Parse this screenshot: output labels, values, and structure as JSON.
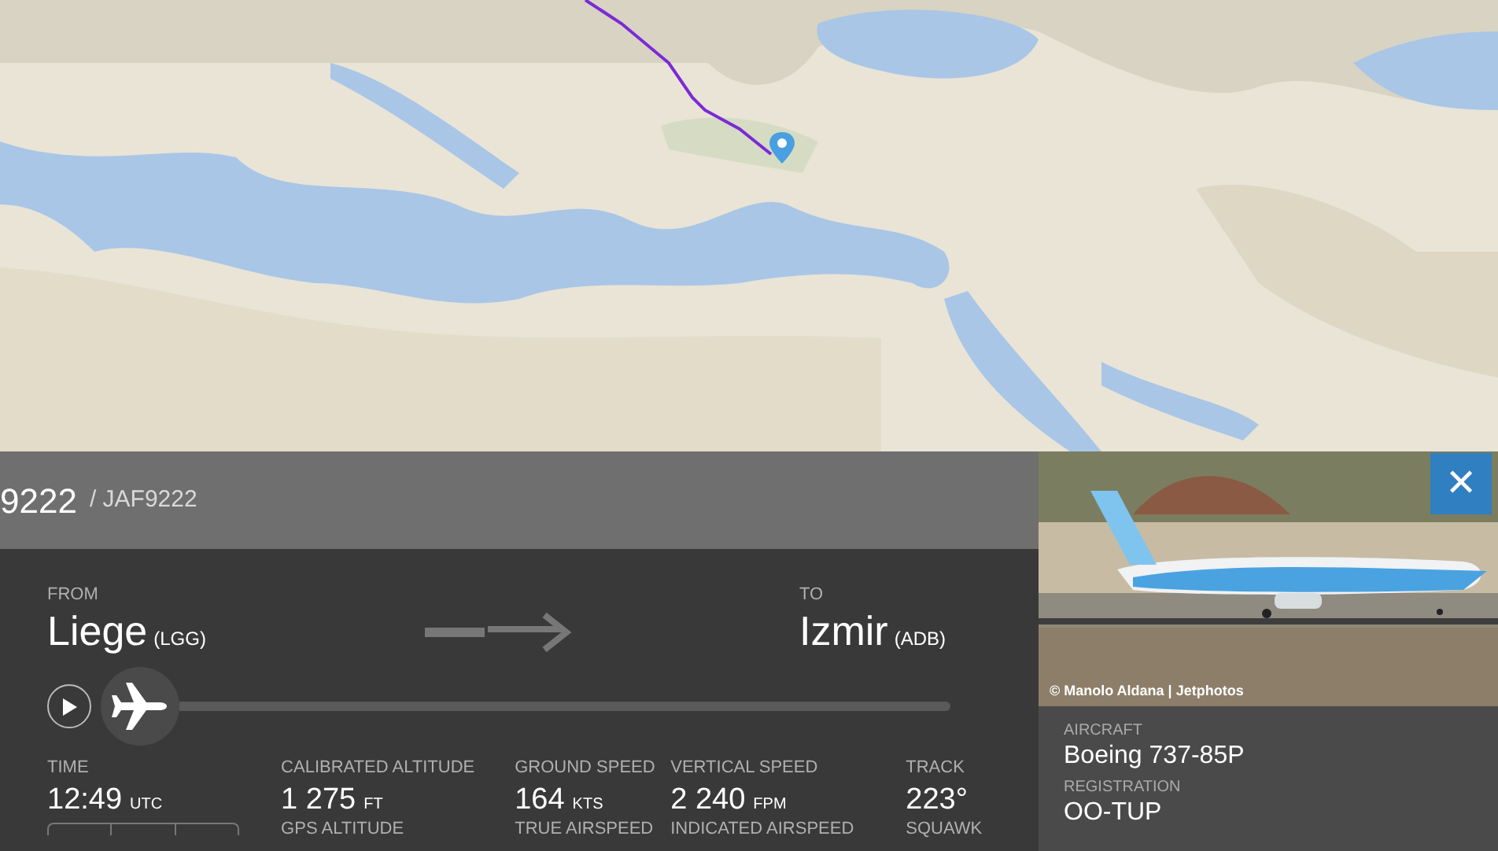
{
  "flight": {
    "number": "9222",
    "callsign": "/ JAF9222",
    "close": "✕"
  },
  "route": {
    "from_label": "FROM",
    "from_city": "Liege",
    "from_code": "(LGG)",
    "to_label": "TO",
    "to_city": "Izmir",
    "to_code": "(ADB)"
  },
  "progress": {
    "level": 0.0
  },
  "stats": [
    {
      "label": "TIME",
      "value": "12:49",
      "unit": "UTC"
    },
    {
      "label": "CALIBRATED ALTITUDE",
      "value": "1 275",
      "unit": "FT",
      "next_label": "GPS ALTITUDE"
    },
    {
      "label": "GROUND SPEED",
      "value": "164",
      "unit": "KTS",
      "next_label": "TRUE AIRSPEED"
    },
    {
      "label": "VERTICAL SPEED",
      "value": "2 240",
      "unit": "FPM",
      "next_label": "INDICATED AIRSPEED"
    },
    {
      "label": "TRACK",
      "value": "223°",
      "next_label": "SQUAWK"
    }
  ],
  "photo": {
    "credit": "© Manolo Aldana | Jetphotos"
  },
  "aircraft": [
    {
      "label": "AIRCRAFT",
      "value": "Boeing 737-85P"
    },
    {
      "label": "REGISTRATION",
      "value": "OO-TUP"
    }
  ]
}
